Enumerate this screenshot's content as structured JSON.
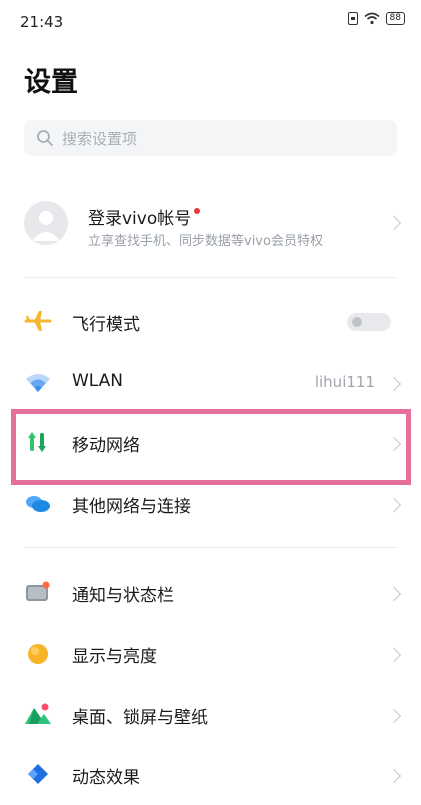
{
  "status_bar": {
    "time": "21:43",
    "battery": "88"
  },
  "page": {
    "title": "设置"
  },
  "search": {
    "placeholder": "搜索设置项",
    "icon": "search-icon"
  },
  "account": {
    "title": "登录vivo帐号",
    "subtitle": "立享查找手机、同步数据等vivo会员特权"
  },
  "settings": [
    {
      "label": "飞行模式",
      "icon": "airplane-icon",
      "toggle": false
    },
    {
      "label": "WLAN",
      "icon": "wifi-icon",
      "value": "lihui111"
    },
    {
      "label": "移动网络",
      "icon": "mobile-data-icon",
      "highlighted": true
    },
    {
      "label": "其他网络与连接",
      "icon": "cloud-icon"
    },
    {
      "label": "通知与状态栏",
      "icon": "notification-icon"
    },
    {
      "label": "显示与亮度",
      "icon": "brightness-icon"
    },
    {
      "label": "桌面、锁屏与壁纸",
      "icon": "wallpaper-icon"
    },
    {
      "label": "动态效果",
      "icon": "animation-icon"
    }
  ],
  "colors": {
    "highlight": "#e4709b",
    "airplane": "#f5b730",
    "wifi": "#3a8cf0",
    "mobile_data": "#34c26b",
    "brightness": "#f7b429",
    "red_dot": "#e53935"
  }
}
